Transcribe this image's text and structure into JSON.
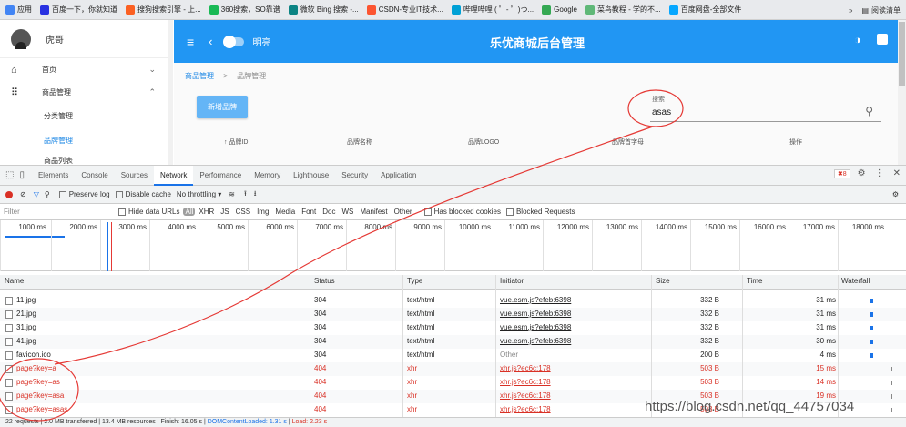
{
  "bookmarks": {
    "items": [
      {
        "label": "应用",
        "color": "#4285f4"
      },
      {
        "label": "百度一下，你就知道",
        "color": "#2932e1"
      },
      {
        "label": "搜狗搜索引擎 - 上...",
        "color": "#fb6022"
      },
      {
        "label": "360搜索，SO靠谱",
        "color": "#19b955"
      },
      {
        "label": "微软 Bing 搜索 -...",
        "color": "#0c8484"
      },
      {
        "label": "CSDN-专业IT技术...",
        "color": "#fc5531"
      },
      {
        "label": "哔哩哔哩 ( ゜- ゜)つ...",
        "color": "#00a1d6"
      },
      {
        "label": "Google",
        "color": "#34a853"
      },
      {
        "label": "菜鸟教程 - 学的不...",
        "color": "#5fb878"
      },
      {
        "label": "百度网盘-全部文件",
        "color": "#06a7ff"
      }
    ],
    "more": "»",
    "reading_list": "阅读清单"
  },
  "app": {
    "user_name": "虎哥",
    "nav_home": "首页",
    "nav_goods": "商品管理",
    "sub_category": "分类管理",
    "sub_brand": "品牌管理",
    "sub_list": "商品列表",
    "header_mode": "明亮",
    "header_title": "乐优商城后台管理",
    "breadcrumb_1": "商品管理",
    "breadcrumb_sep": ">",
    "breadcrumb_2": "品牌管理",
    "add_brand": "新增品牌",
    "search_label": "搜索",
    "search_value": "asas",
    "columns": [
      "品牌ID",
      "品牌名称",
      "品牌LOGO",
      "品牌首字母",
      "操作"
    ]
  },
  "devtools": {
    "tabs": [
      "Elements",
      "Console",
      "Sources",
      "Network",
      "Performance",
      "Memory",
      "Lighthouse",
      "Security",
      "Application"
    ],
    "active_tab": "Network",
    "error_count": "8",
    "preserve_log": "Preserve log",
    "disable_cache": "Disable cache",
    "throttling": "No throttling",
    "filter_placeholder": "Filter",
    "hide_data_urls": "Hide data URLs",
    "all": "All",
    "types": [
      "XHR",
      "JS",
      "CSS",
      "Img",
      "Media",
      "Font",
      "Doc",
      "WS",
      "Manifest",
      "Other"
    ],
    "blocked_cookies": "Has blocked cookies",
    "blocked_requests": "Blocked Requests",
    "ticks": [
      "1000 ms",
      "2000 ms",
      "3000 ms",
      "4000 ms",
      "5000 ms",
      "6000 ms",
      "7000 ms",
      "8000 ms",
      "9000 ms",
      "10000 ms",
      "11000 ms",
      "12000 ms",
      "13000 ms",
      "14000 ms",
      "15000 ms",
      "16000 ms",
      "17000 ms",
      "18000 ms"
    ],
    "headers": [
      "Name",
      "Status",
      "Type",
      "Initiator",
      "Size",
      "Time",
      "Waterfall"
    ],
    "rows": [
      {
        "name": "11.jpg",
        "status": "304",
        "type": "text/html",
        "initiator": "vue.esm.js?efeb:6398",
        "size": "332 B",
        "time": "31 ms",
        "error": false
      },
      {
        "name": "21.jpg",
        "status": "304",
        "type": "text/html",
        "initiator": "vue.esm.js?efeb:6398",
        "size": "332 B",
        "time": "31 ms",
        "error": false
      },
      {
        "name": "31.jpg",
        "status": "304",
        "type": "text/html",
        "initiator": "vue.esm.js?efeb:6398",
        "size": "332 B",
        "time": "31 ms",
        "error": false
      },
      {
        "name": "41.jpg",
        "status": "304",
        "type": "text/html",
        "initiator": "vue.esm.js?efeb:6398",
        "size": "332 B",
        "time": "30 ms",
        "error": false
      },
      {
        "name": "favicon.ico",
        "status": "304",
        "type": "text/html",
        "initiator": "Other",
        "size": "200 B",
        "time": "4 ms",
        "error": false
      },
      {
        "name": "page?key=a",
        "status": "404",
        "type": "xhr",
        "initiator": "xhr.js?ec6c:178",
        "size": "503 B",
        "time": "15 ms",
        "error": true
      },
      {
        "name": "page?key=as",
        "status": "404",
        "type": "xhr",
        "initiator": "xhr.js?ec6c:178",
        "size": "503 B",
        "time": "14 ms",
        "error": true
      },
      {
        "name": "page?key=asa",
        "status": "404",
        "type": "xhr",
        "initiator": "xhr.js?ec6c:178",
        "size": "503 B",
        "time": "19 ms",
        "error": true
      },
      {
        "name": "page?key=asas",
        "status": "404",
        "type": "xhr",
        "initiator": "xhr.js?ec6c:178",
        "size": "503 B",
        "time": "",
        "error": true
      }
    ],
    "status_bar": {
      "requests": "22 requests",
      "transferred": "2.0 MB transferred",
      "resources": "13.4 MB resources",
      "finish": "Finish: 16.05 s",
      "dcl": "DOMContentLoaded: 1.31 s",
      "load": "Load: 2.23 s"
    }
  },
  "watermark": "https://blog.csdn.net/qq_44757034",
  "colors": {
    "accent": "#2196f3",
    "error": "#d93025",
    "annotation": "#e53935"
  }
}
